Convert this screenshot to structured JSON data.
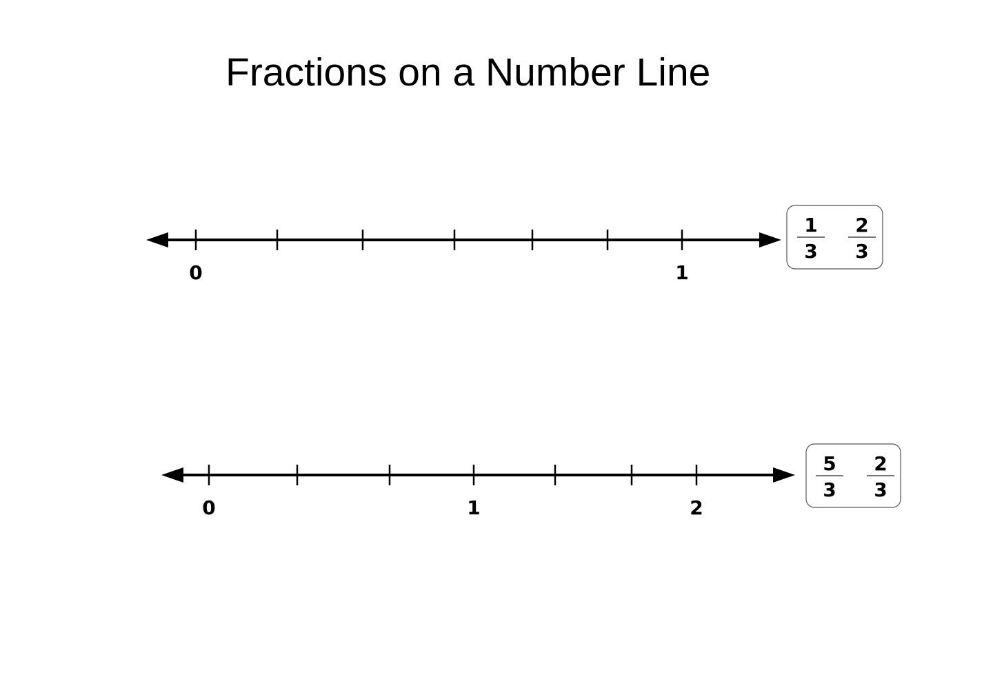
{
  "title": "Fractions on a Number Line",
  "number_lines": [
    {
      "range": [
        0,
        1
      ],
      "labels": [
        {
          "value": 0,
          "text": "0"
        },
        {
          "value": 1,
          "text": "1"
        }
      ],
      "fraction_cards": [
        {
          "numerator": "1",
          "denominator": "3"
        },
        {
          "numerator": "2",
          "denominator": "3"
        }
      ]
    },
    {
      "range": [
        0,
        2
      ],
      "labels": [
        {
          "value": 0,
          "text": "0"
        },
        {
          "value": 1,
          "text": "1"
        },
        {
          "value": 2,
          "text": "2"
        }
      ],
      "fraction_cards": [
        {
          "numerator": "5",
          "denominator": "3"
        },
        {
          "numerator": "2",
          "denominator": "3"
        }
      ]
    }
  ]
}
